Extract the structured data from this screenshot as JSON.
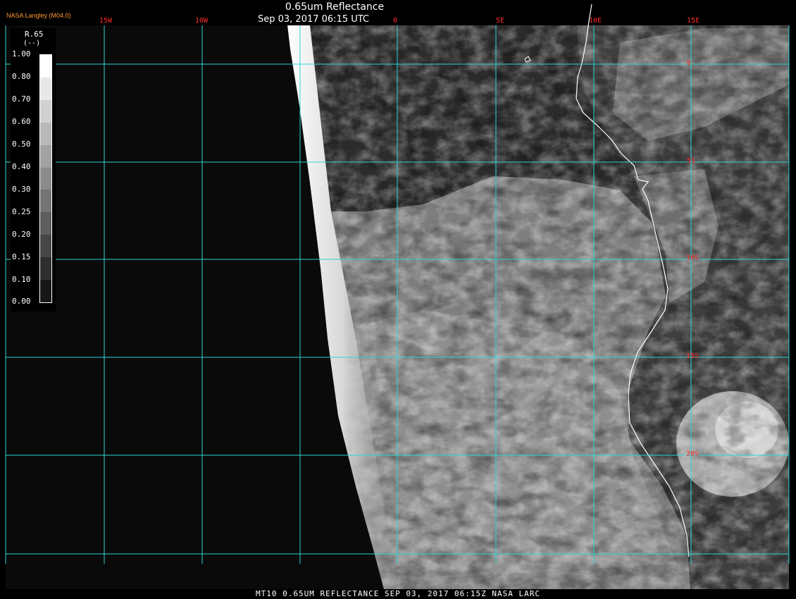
{
  "header": {
    "title": "0.65um Reflectance",
    "subtitle": "Sep 03, 2017 06:15 UTC",
    "credit": "NASA Langley (M04.0)"
  },
  "colorbar": {
    "label": "R.65",
    "units": "(--)",
    "ticks": [
      "1.00",
      "0.80",
      "0.70",
      "0.60",
      "0.50",
      "0.40",
      "0.30",
      "0.25",
      "0.20",
      "0.15",
      "0.10",
      "0.00"
    ]
  },
  "grid": {
    "lon_labels": [
      "15W",
      "10W",
      "0",
      "5E",
      "10E",
      "15E"
    ],
    "lat_labels": [
      "0",
      "5S",
      "10S",
      "15S",
      "20S"
    ]
  },
  "footer": {
    "text": "MT10  0.65UM REFLECTANCE   SEP 03, 2017 06:15Z   NASA LARC"
  },
  "colors": {
    "grid": "#2fd3d3",
    "coastline": "#ffffff",
    "labels": "#ff2a2a",
    "credit": "#ff9a33"
  }
}
